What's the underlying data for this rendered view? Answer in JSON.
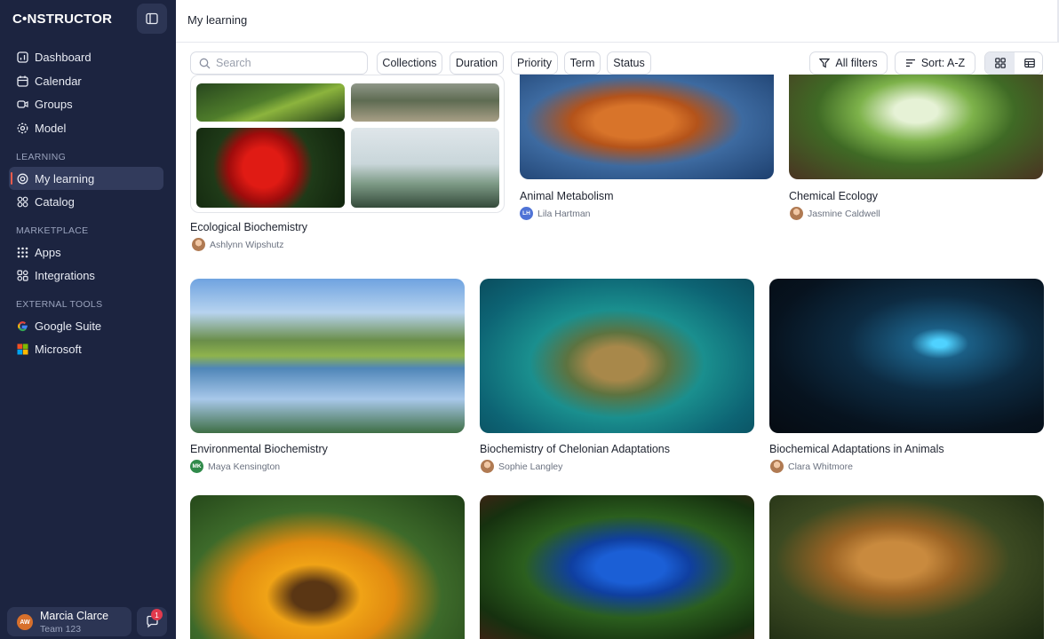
{
  "app": {
    "logo": "C•NSTRUCTOR"
  },
  "header": {
    "title": "My learning"
  },
  "sidebar": {
    "main_items": [
      {
        "label": "Dashboard",
        "icon": "dashboard-icon"
      },
      {
        "label": "Calendar",
        "icon": "calendar-icon"
      },
      {
        "label": "Groups",
        "icon": "groups-icon"
      },
      {
        "label": "Model",
        "icon": "model-icon"
      }
    ],
    "sections": {
      "learning": "LEARNING",
      "marketplace": "MARKETPLACE",
      "external_tools": "EXTERNAL TOOLS"
    },
    "learning_items": [
      {
        "label": "My learning",
        "icon": "my-learning-icon",
        "active": true
      },
      {
        "label": "Catalog",
        "icon": "catalog-icon"
      }
    ],
    "marketplace_items": [
      {
        "label": "Apps",
        "icon": "apps-icon"
      },
      {
        "label": "Integrations",
        "icon": "integrations-icon"
      }
    ],
    "external_items": [
      {
        "label": "Google Suite",
        "icon": "google-icon"
      },
      {
        "label": "Microsoft",
        "icon": "microsoft-icon"
      }
    ],
    "user": {
      "name": "Marcia Clarce",
      "team": "Team 123",
      "initials": "AW"
    },
    "chat_badge": "1"
  },
  "toolbar": {
    "search_placeholder": "Search",
    "filters": [
      "Collections",
      "Duration",
      "Priority",
      "Term",
      "Status"
    ],
    "all_filters": "All filters",
    "sort": "Sort: A-Z"
  },
  "courses": [
    {
      "title": "Ecological Biochemistry",
      "author": "Ashlynn Wipshutz"
    },
    {
      "title": "Animal Metabolism",
      "author": "Lila Hartman",
      "initials": "LH"
    },
    {
      "title": "Chemical Ecology",
      "author": "Jasmine Caldwell"
    },
    {
      "title": "Environmental Biochemistry",
      "author": "Maya Kensington",
      "initials": "MK"
    },
    {
      "title": "Biochemistry of Chelonian Adaptations",
      "author": "Sophie Langley"
    },
    {
      "title": "Biochemical Adaptations in Animals",
      "author": "Clara Whitmore"
    }
  ],
  "colors": {
    "sidebar_bg": "#1c2440",
    "active_accent": "#ef5b4b",
    "badge": "#e23a4d"
  }
}
